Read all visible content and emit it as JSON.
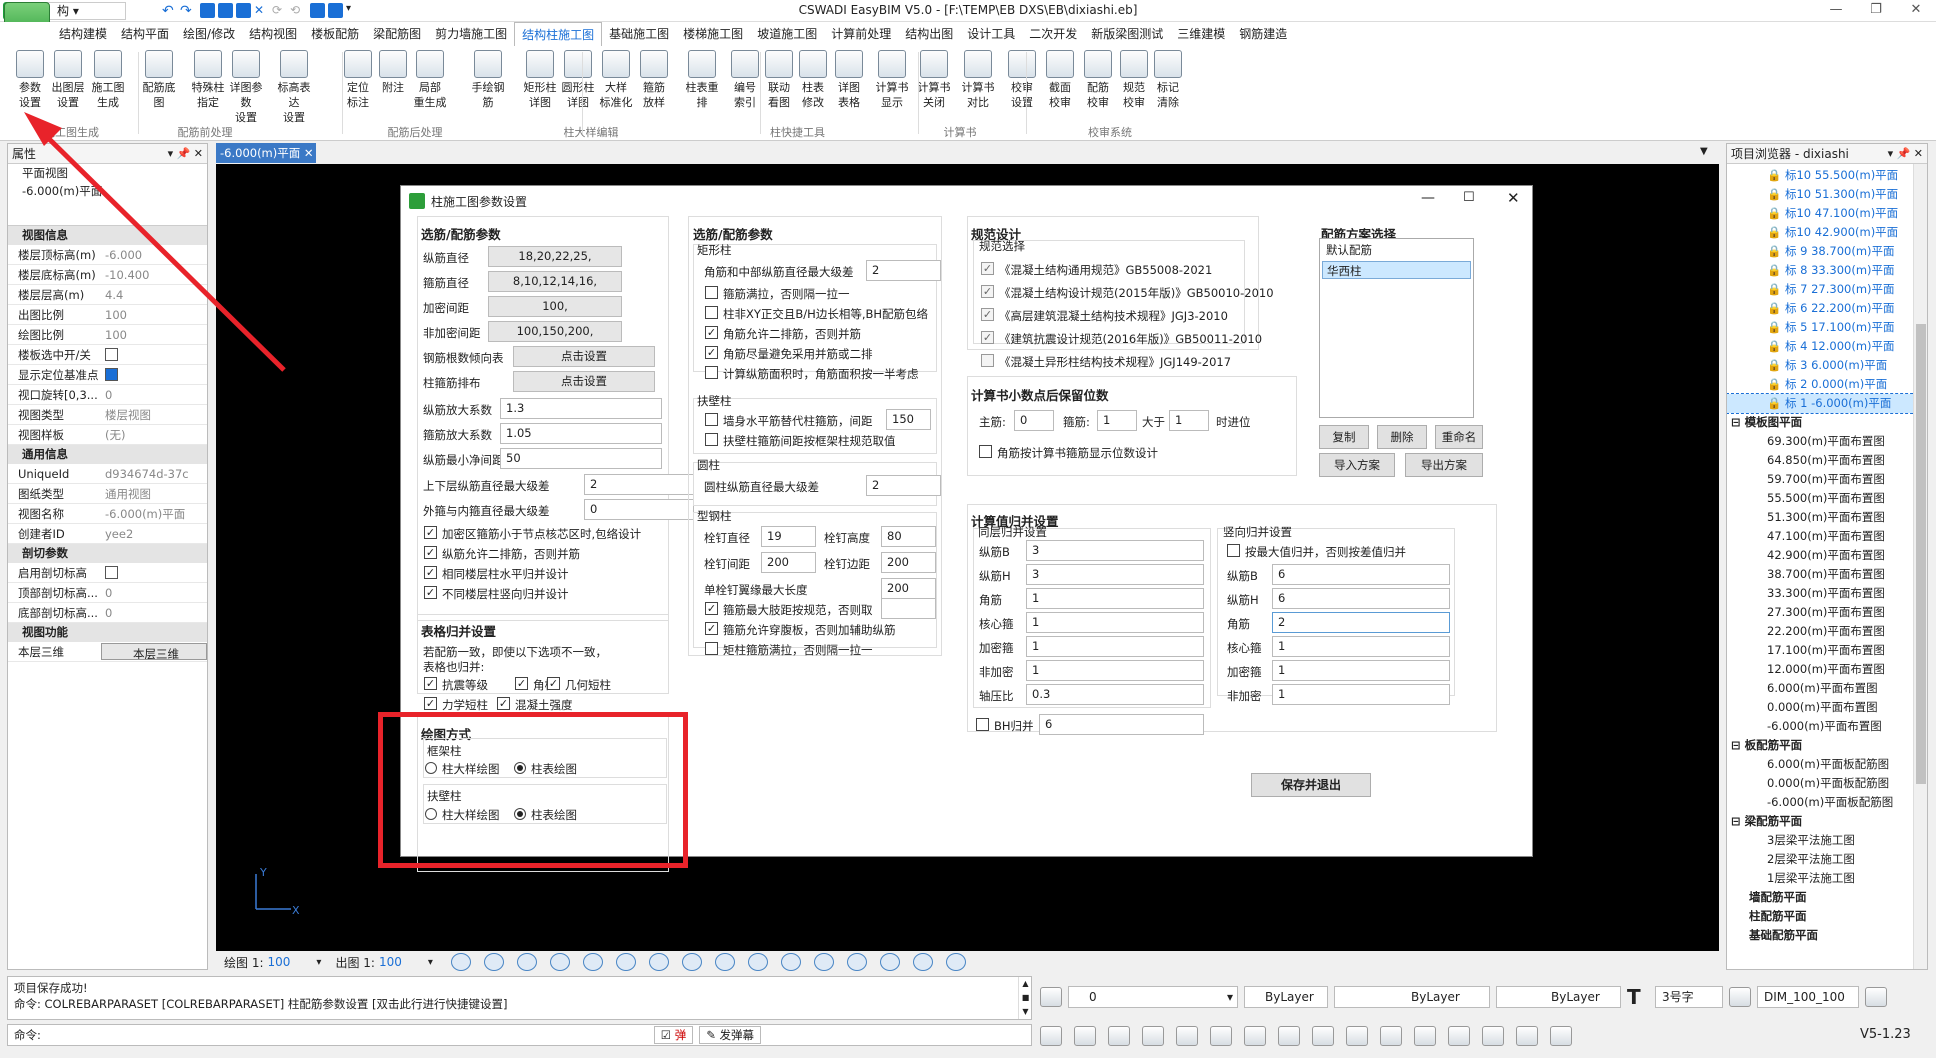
{
  "app": {
    "title": "CSWADI EasyBIM V5.0 - [F:\\TEMP\\EB DXS\\EB\\dixiashi.eb]",
    "workspace": "结　构"
  },
  "colors": {
    "accent": "#1a6fd6",
    "highlight_box": "#e8232a",
    "canvas_bg": "#000000",
    "selected": "#cce8ff"
  },
  "menus": [
    "结构建模",
    "结构平面",
    "绘图/修改",
    "结构视图",
    "楼板配筋",
    "梁配筋图",
    "剪力墙施工图",
    "结构柱施工图",
    "基础施工图",
    "楼梯施工图",
    "坡道施工图",
    "计算前处理",
    "结构出图",
    "设计工具",
    "二次开发",
    "新版梁图测试",
    "三维建模",
    "钢筋建造"
  ],
  "active_menu": "结构柱施工图",
  "ribbon": {
    "buttons": [
      "参数\n设置",
      "出图层\n设置",
      "施工图\n生成",
      "配筋底图",
      "特殊柱\n指定",
      "详图参数\n设置",
      "标高表达\n设置",
      "定位\n标注",
      "附注",
      "局部\n重生成",
      "手绘钢筋",
      "矩形柱\n详图",
      "圆形柱\n详图",
      "大样\n标准化",
      "箍筋\n放样",
      "柱表重排",
      "编号\n索引",
      "联动\n看图",
      "柱表\n修改",
      "详图\n表格",
      "计算书\n显示",
      "计算书\n关闭",
      "计算书\n对比",
      "校审\n设置",
      "截面\n校审",
      "配筋\n校审",
      "规范\n校审",
      "标记\n清除"
    ],
    "groups": [
      "施工图生成",
      "配筋前处理",
      "配筋后处理",
      "柱大样编辑",
      "柱快捷工具",
      "计算书",
      "校审系统"
    ]
  },
  "props": {
    "title": "属性",
    "view_name": "平面视图",
    "level": "-6.000(m)平面",
    "categories": [
      {
        "name": "视图信息",
        "rows": [
          [
            "楼层顶标高(m)",
            "-6.000"
          ],
          [
            "楼层底标高(m)",
            "-10.400"
          ],
          [
            "楼层层高(m)",
            "4.4"
          ],
          [
            "出图比例",
            "100"
          ],
          [
            "绘图比例",
            "100"
          ],
          [
            "楼板选中开/关",
            ""
          ],
          [
            "显示定位基准点",
            ""
          ],
          [
            "视口旋转[0,3...",
            "0"
          ],
          [
            "视图类型",
            "楼层视图"
          ],
          [
            "视图样板",
            "(无)"
          ]
        ]
      },
      {
        "name": "通用信息",
        "rows": [
          [
            "UniqueId",
            "d934674d-37c"
          ],
          [
            "图纸类型",
            "通用视图"
          ],
          [
            "视图名称",
            "-6.000(m)平面"
          ],
          [
            "创建者ID",
            "yee2"
          ]
        ]
      },
      {
        "name": "剖切参数",
        "rows": [
          [
            "启用剖切标高",
            ""
          ],
          [
            "顶部剖切标高...",
            "0"
          ],
          [
            "底部剖切标高...",
            "0"
          ]
        ]
      },
      {
        "name": "视图功能",
        "rows": [
          [
            "本层三维",
            "本层三维"
          ]
        ]
      }
    ]
  },
  "doc_tab": "-6.000(m)平面",
  "browser": {
    "title": "项目浏览器 - dixiashi",
    "levels": [
      "标10 55.500(m)平面",
      "标10 51.300(m)平面",
      "标10 47.100(m)平面",
      "标10 42.900(m)平面",
      "标 9 38.700(m)平面",
      "标 8 33.300(m)平面",
      "标 7 27.300(m)平面",
      "标 6 22.200(m)平面",
      "标 5 17.100(m)平面",
      "标 4 12.000(m)平面",
      "标 3 6.000(m)平面",
      "标 2 0.000(m)平面",
      "标 1 -6.000(m)平面"
    ],
    "section_template": "模板图平面",
    "template_items": [
      "69.300(m)平面布置图",
      "64.850(m)平面布置图",
      "59.700(m)平面布置图",
      "55.500(m)平面布置图",
      "51.300(m)平面布置图",
      "47.100(m)平面布置图",
      "42.900(m)平面布置图",
      "38.700(m)平面布置图",
      "33.300(m)平面布置图",
      "27.300(m)平面布置图",
      "22.200(m)平面布置图",
      "17.100(m)平面布置图",
      "12.000(m)平面布置图",
      "6.000(m)平面布置图",
      "0.000(m)平面布置图",
      "-6.000(m)平面布置图"
    ],
    "section_slab": "板配筋平面",
    "slab_items": [
      "6.000(m)平面板配筋图",
      "0.000(m)平面板配筋图",
      "-6.000(m)平面板配筋图"
    ],
    "section_beam": "梁配筋平面",
    "beam_items": [
      "3层梁平法施工图",
      "2层梁平法施工图",
      "1层梁平法施工图"
    ],
    "tail": [
      "墙配筋平面",
      "柱配筋平面",
      "基础配筋平面"
    ]
  },
  "dialog": {
    "title": "柱施工图参数设置",
    "c1": {
      "section": "选筋/配筋参数",
      "fields": [
        [
          "纵筋直径",
          "18,20,22,25,"
        ],
        [
          "箍筋直径",
          "8,10,12,14,16,"
        ],
        [
          "加密间距",
          "100,"
        ],
        [
          "非加密间距",
          "100,150,200,"
        ],
        [
          "钢筋根数倾向表",
          "点击设置"
        ],
        [
          "柱箍筋排布",
          "点击设置"
        ]
      ],
      "inputs": [
        [
          "纵筋放大系数",
          "1.3"
        ],
        [
          "箍筋放大系数",
          "1.05"
        ],
        [
          "纵筋最小净间距",
          "50"
        ],
        [
          "上下层纵筋直径最大级差",
          "2"
        ],
        [
          "外箍与内箍直径最大级差",
          "0"
        ]
      ],
      "checks": [
        "加密区箍筋小于节点核芯区时,包络设计",
        "纵筋允许二排筋，否则并筋",
        "相同楼层柱水平归并设计",
        "不同楼层柱竖向归并设计"
      ],
      "table_section": "表格归并设置",
      "table_note1": "若配筋一致，即使以下选项不一致，",
      "table_note2": "表格也归并:",
      "table_checks": [
        "抗震等级",
        "角柱",
        "几何短柱",
        "力学短柱",
        "混凝土强度"
      ],
      "draw_section": "绘图方式",
      "frame_col": "框架柱",
      "wall_col": "扶壁柱",
      "opt_a": "柱大样绘图",
      "opt_b": "柱表绘图"
    },
    "c2": {
      "section": "选筋/配筋参数",
      "rect": "矩形柱",
      "rect_f1": "角筋和中部纵筋直径最大级差",
      "rect_v1": "2",
      "rect_checks": [
        "箍筋满拉，否则隔一拉一",
        "柱非XY正交且B/H边长相等,BH配筋包络",
        "角筋允许二排筋，否则并筋",
        "角筋尽量避免采用并筋或二排",
        "计算纵筋面积时，角筋面积按一半考虑"
      ],
      "wall": "扶壁柱",
      "wall_c1": "墙身水平筋替代柱箍筋，间距",
      "wall_v1": "150",
      "wall_c2": "扶壁柱箍筋间距按框架柱规范取值",
      "round": "圆柱",
      "round_f": "圆柱纵筋直径最大级差",
      "round_v": "2",
      "steel": "型钢柱",
      "s1": "栓钉直径",
      "s1v": "19",
      "s2": "栓钉高度",
      "s2v": "80",
      "s3": "栓钉间距",
      "s3v": "200",
      "s4": "栓钉边距",
      "s4v": "200",
      "s5": "单栓钉翼缘最大长度",
      "s5v": "200",
      "steel_checks": [
        "箍筋最大肢距按规范，否则取",
        "箍筋允许穿腹板，否则加辅助纵筋",
        "矩柱箍筋满拉，否则隔一拉一"
      ]
    },
    "c3": {
      "section": "规范设计",
      "sub": "规范选择",
      "codes": [
        "《混凝土结构通用规范》GB55008-2021",
        "《混凝土结构设计规范(2015年版)》GB50010-2010",
        "《高层建筑混凝土结构技术规程》JGJ3-2010",
        "《建筑抗震设计规范(2016年版)》GB50011-2010",
        "《混凝土异形柱结构技术规程》JGJ149-2017"
      ],
      "dec_section": "计算书小数点后保留位数",
      "main_l": "主筋:",
      "main_v": "0",
      "stir_l": "箍筋:",
      "stir_v": "1",
      "gt_l": "大于",
      "gt_v": "1",
      "carry": "时进位",
      "dec_check": "角筋按计算书箍筋显示位数设计",
      "merge_section": "计算值归并设置",
      "same_floor": "同层归并设置",
      "same_rows": [
        [
          "纵筋B",
          "3"
        ],
        [
          "纵筋H",
          "3"
        ],
        [
          "角筋",
          "1"
        ],
        [
          "核心箍",
          "1"
        ],
        [
          "加密箍",
          "1"
        ],
        [
          "非加密",
          "1"
        ],
        [
          "轴压比",
          "0.3"
        ]
      ],
      "bh_l": "BH归并",
      "bh_v": "6",
      "vert": "竖向归并设置",
      "vert_check": "按最大值归并，否则按差值归并",
      "vert_rows": [
        [
          "纵筋B",
          "6"
        ],
        [
          "纵筋H",
          "6"
        ],
        [
          "角筋",
          "2"
        ],
        [
          "核心箍",
          "1"
        ],
        [
          "加密箍",
          "1"
        ],
        [
          "非加密",
          "1"
        ]
      ],
      "save": "保存并退出"
    },
    "c4": {
      "section": "配筋方案选择",
      "schemes": [
        "默认配筋",
        "华西柱"
      ],
      "selected": "华西柱",
      "btns": [
        "复制",
        "删除",
        "重命名",
        "导入方案",
        "导出方案"
      ]
    }
  },
  "bottom": {
    "draw_scale_l": "绘图 1:",
    "draw_scale": "100",
    "out_scale_l": "出图 1:",
    "out_scale": "100",
    "status1": "项目保存成功!",
    "status2": "命令: COLREBARPARASET [COLREBARPARASET] 柱配筋参数设置 [双击此行进行快捷键设置]",
    "cmd": "命令:",
    "tan": "弹",
    "fadan": "发弹幕",
    "layer": "0",
    "bylayer1": "ByLayer",
    "bylayer2": "ByLayer",
    "bylayer3": "ByLayer",
    "font_size": "3号字",
    "dim": "DIM_100_100",
    "version": "V5-1.23"
  }
}
